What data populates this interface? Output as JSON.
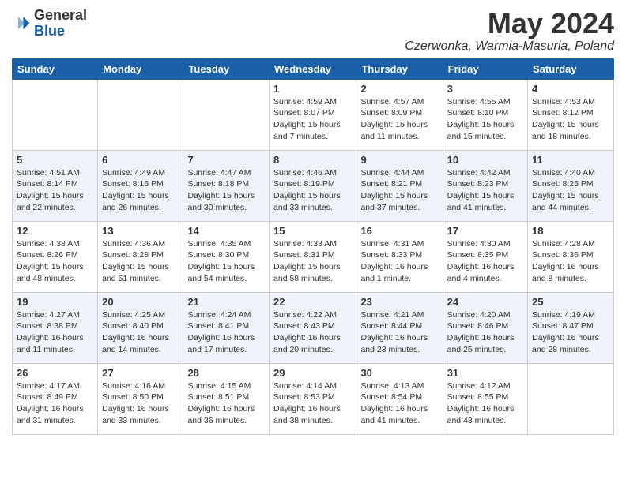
{
  "header": {
    "logo_general": "General",
    "logo_blue": "Blue",
    "month_title": "May 2024",
    "location": "Czerwonka, Warmia-Masuria, Poland"
  },
  "days_of_week": [
    "Sunday",
    "Monday",
    "Tuesday",
    "Wednesday",
    "Thursday",
    "Friday",
    "Saturday"
  ],
  "weeks": [
    [
      {
        "day": "",
        "info": ""
      },
      {
        "day": "",
        "info": ""
      },
      {
        "day": "",
        "info": ""
      },
      {
        "day": "1",
        "info": "Sunrise: 4:59 AM\nSunset: 8:07 PM\nDaylight: 15 hours\nand 7 minutes."
      },
      {
        "day": "2",
        "info": "Sunrise: 4:57 AM\nSunset: 8:09 PM\nDaylight: 15 hours\nand 11 minutes."
      },
      {
        "day": "3",
        "info": "Sunrise: 4:55 AM\nSunset: 8:10 PM\nDaylight: 15 hours\nand 15 minutes."
      },
      {
        "day": "4",
        "info": "Sunrise: 4:53 AM\nSunset: 8:12 PM\nDaylight: 15 hours\nand 18 minutes."
      }
    ],
    [
      {
        "day": "5",
        "info": "Sunrise: 4:51 AM\nSunset: 8:14 PM\nDaylight: 15 hours\nand 22 minutes."
      },
      {
        "day": "6",
        "info": "Sunrise: 4:49 AM\nSunset: 8:16 PM\nDaylight: 15 hours\nand 26 minutes."
      },
      {
        "day": "7",
        "info": "Sunrise: 4:47 AM\nSunset: 8:18 PM\nDaylight: 15 hours\nand 30 minutes."
      },
      {
        "day": "8",
        "info": "Sunrise: 4:46 AM\nSunset: 8:19 PM\nDaylight: 15 hours\nand 33 minutes."
      },
      {
        "day": "9",
        "info": "Sunrise: 4:44 AM\nSunset: 8:21 PM\nDaylight: 15 hours\nand 37 minutes."
      },
      {
        "day": "10",
        "info": "Sunrise: 4:42 AM\nSunset: 8:23 PM\nDaylight: 15 hours\nand 41 minutes."
      },
      {
        "day": "11",
        "info": "Sunrise: 4:40 AM\nSunset: 8:25 PM\nDaylight: 15 hours\nand 44 minutes."
      }
    ],
    [
      {
        "day": "12",
        "info": "Sunrise: 4:38 AM\nSunset: 8:26 PM\nDaylight: 15 hours\nand 48 minutes."
      },
      {
        "day": "13",
        "info": "Sunrise: 4:36 AM\nSunset: 8:28 PM\nDaylight: 15 hours\nand 51 minutes."
      },
      {
        "day": "14",
        "info": "Sunrise: 4:35 AM\nSunset: 8:30 PM\nDaylight: 15 hours\nand 54 minutes."
      },
      {
        "day": "15",
        "info": "Sunrise: 4:33 AM\nSunset: 8:31 PM\nDaylight: 15 hours\nand 58 minutes."
      },
      {
        "day": "16",
        "info": "Sunrise: 4:31 AM\nSunset: 8:33 PM\nDaylight: 16 hours\nand 1 minute."
      },
      {
        "day": "17",
        "info": "Sunrise: 4:30 AM\nSunset: 8:35 PM\nDaylight: 16 hours\nand 4 minutes."
      },
      {
        "day": "18",
        "info": "Sunrise: 4:28 AM\nSunset: 8:36 PM\nDaylight: 16 hours\nand 8 minutes."
      }
    ],
    [
      {
        "day": "19",
        "info": "Sunrise: 4:27 AM\nSunset: 8:38 PM\nDaylight: 16 hours\nand 11 minutes."
      },
      {
        "day": "20",
        "info": "Sunrise: 4:25 AM\nSunset: 8:40 PM\nDaylight: 16 hours\nand 14 minutes."
      },
      {
        "day": "21",
        "info": "Sunrise: 4:24 AM\nSunset: 8:41 PM\nDaylight: 16 hours\nand 17 minutes."
      },
      {
        "day": "22",
        "info": "Sunrise: 4:22 AM\nSunset: 8:43 PM\nDaylight: 16 hours\nand 20 minutes."
      },
      {
        "day": "23",
        "info": "Sunrise: 4:21 AM\nSunset: 8:44 PM\nDaylight: 16 hours\nand 23 minutes."
      },
      {
        "day": "24",
        "info": "Sunrise: 4:20 AM\nSunset: 8:46 PM\nDaylight: 16 hours\nand 25 minutes."
      },
      {
        "day": "25",
        "info": "Sunrise: 4:19 AM\nSunset: 8:47 PM\nDaylight: 16 hours\nand 28 minutes."
      }
    ],
    [
      {
        "day": "26",
        "info": "Sunrise: 4:17 AM\nSunset: 8:49 PM\nDaylight: 16 hours\nand 31 minutes."
      },
      {
        "day": "27",
        "info": "Sunrise: 4:16 AM\nSunset: 8:50 PM\nDaylight: 16 hours\nand 33 minutes."
      },
      {
        "day": "28",
        "info": "Sunrise: 4:15 AM\nSunset: 8:51 PM\nDaylight: 16 hours\nand 36 minutes."
      },
      {
        "day": "29",
        "info": "Sunrise: 4:14 AM\nSunset: 8:53 PM\nDaylight: 16 hours\nand 38 minutes."
      },
      {
        "day": "30",
        "info": "Sunrise: 4:13 AM\nSunset: 8:54 PM\nDaylight: 16 hours\nand 41 minutes."
      },
      {
        "day": "31",
        "info": "Sunrise: 4:12 AM\nSunset: 8:55 PM\nDaylight: 16 hours\nand 43 minutes."
      },
      {
        "day": "",
        "info": ""
      }
    ]
  ]
}
